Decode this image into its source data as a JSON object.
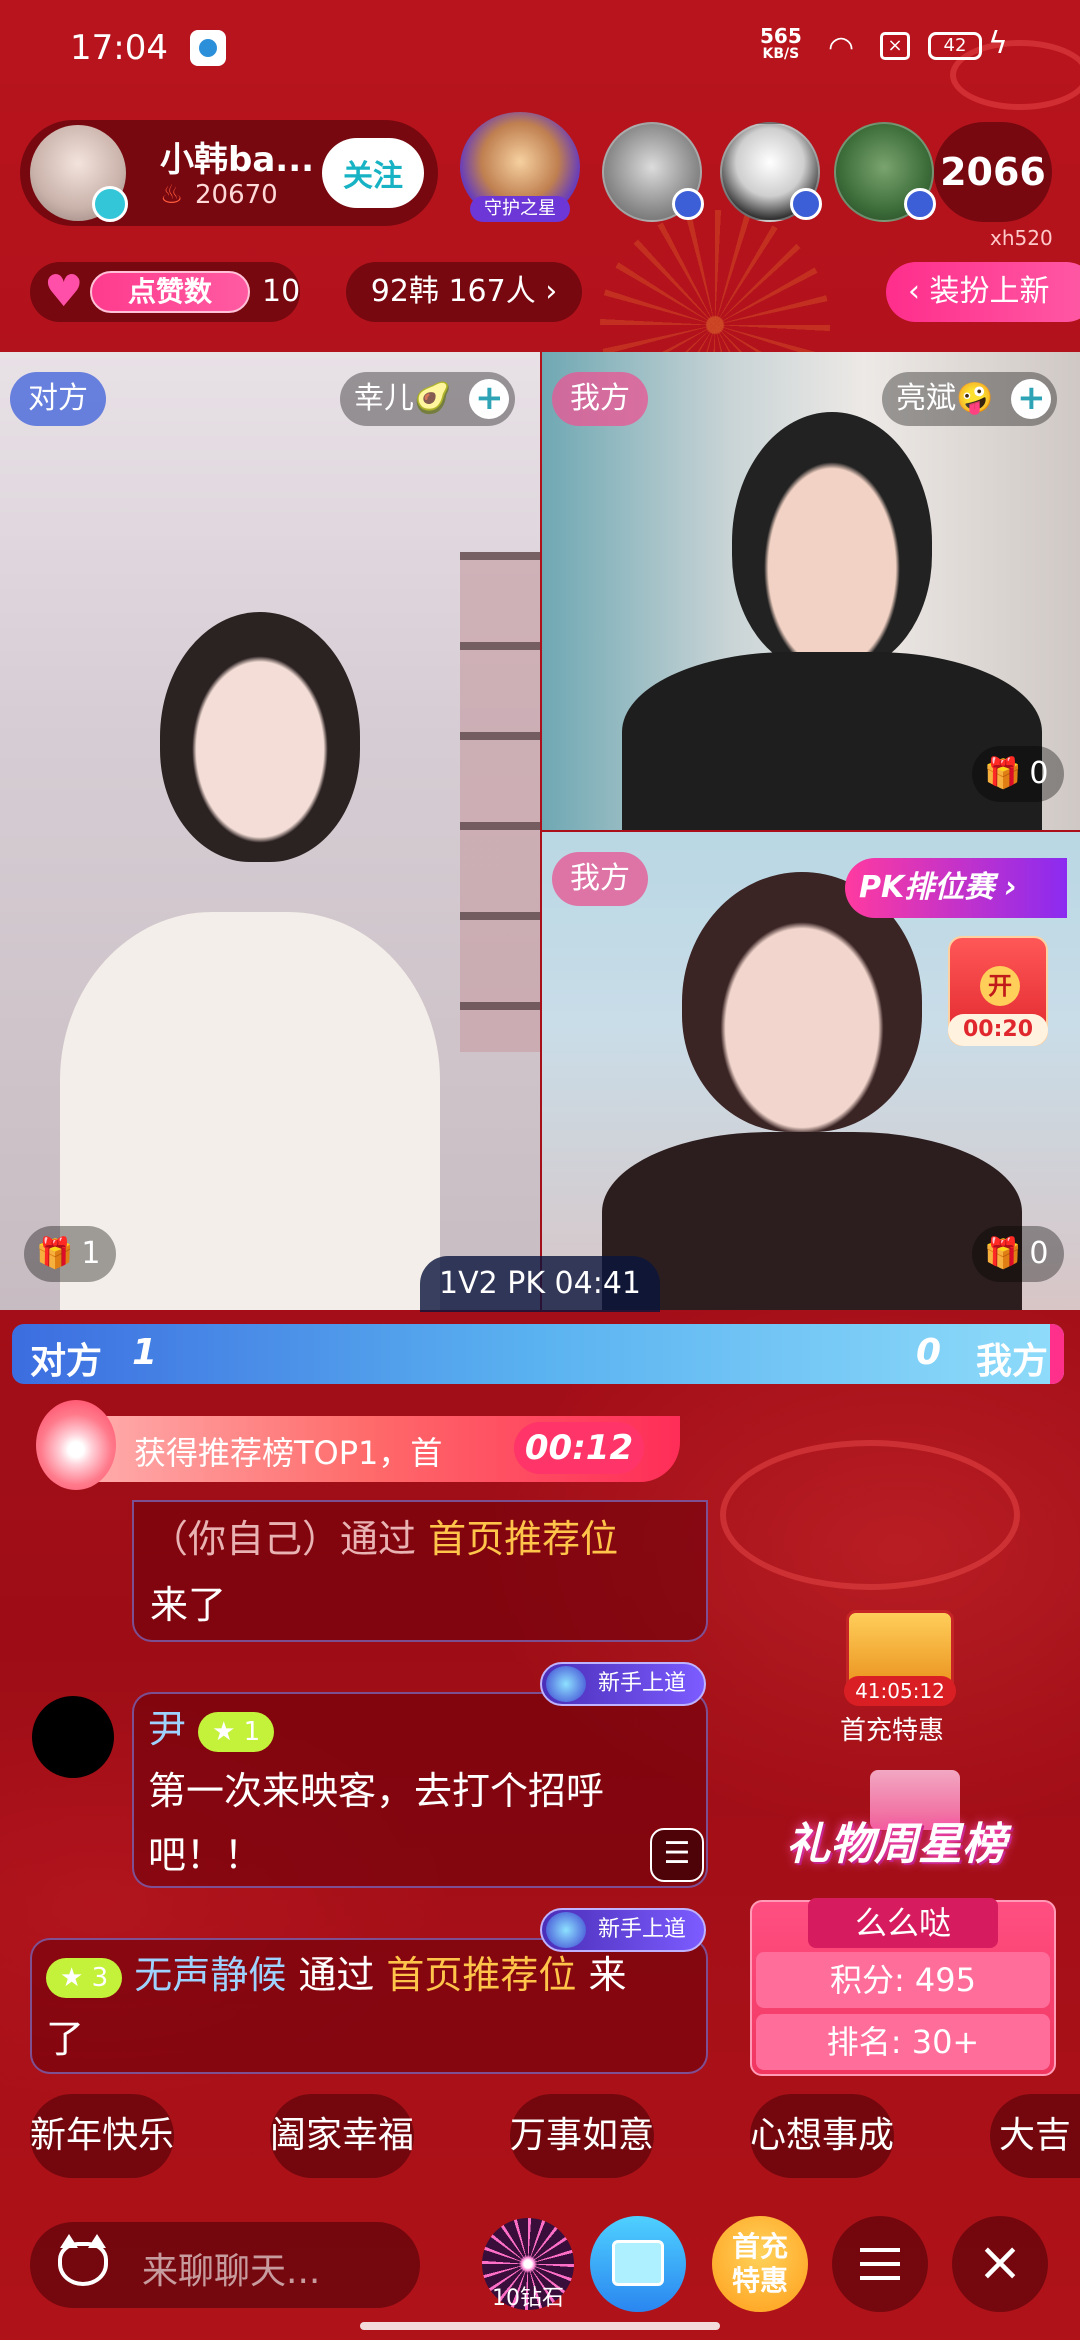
{
  "status_bar": {
    "time": "17:04",
    "net_speed_value": "565",
    "net_speed_unit": "KB/S",
    "battery": "42"
  },
  "header": {
    "host_name": "小韩ba...",
    "host_fans": "20670",
    "follow_label": "关注",
    "guard_label": "守护之星",
    "viewer_count": "2066",
    "user_id": "xh520",
    "likes_label": "点赞数",
    "likes_count": "10",
    "rank_text": "92韩 167人 ›",
    "dress_text": "‹ 装扮上新"
  },
  "pk": {
    "left_tag": "对方",
    "left_name": "幸儿🥑",
    "tr_tag": "我方",
    "tr_name": "亮斌🤪",
    "br_tag": "我方",
    "left_gifts": "1",
    "tr_gifts": "0",
    "br_gifts": "0",
    "timer": "1V2 PK 04:41",
    "rank_badge": "PK排位赛 ›",
    "red_packet_open": "开",
    "red_packet_timer": "00:20",
    "score_left_label": "对方",
    "score_left": "1",
    "score_right": "0",
    "score_right_label": "我方"
  },
  "rec_banner": {
    "text": "获得推荐榜TOP1，首",
    "timer": "00:12"
  },
  "chat": [
    {
      "line1_a": "（你自己）通过 ",
      "line1_b": "首页推荐位",
      "line2": "来了"
    },
    {
      "name": "尹",
      "level": "★ 1",
      "badge": "新手上道",
      "line1": "第一次来映客，去打个招呼",
      "line2": "吧！！"
    },
    {
      "level": "★ 3",
      "badge": "新手上道",
      "name": "无声静候",
      "mid": " 通过 ",
      "place": "首页推荐位",
      "end": " 来",
      "line2": "了"
    }
  ],
  "widgets": {
    "first_charge_timer": "41:05:12",
    "first_charge_label": "首充特惠",
    "gift_week_title": "礼物周星榜",
    "gift_week_name": "么么哒",
    "gift_week_points": "积分: 495",
    "gift_week_rank": "排名: 30+"
  },
  "phrases": [
    "新年快乐",
    "阖家幸福",
    "万事如意",
    "心想事成",
    "大吉"
  ],
  "bottom": {
    "placeholder": "来聊聊天...",
    "firework_label": "10钻石",
    "charge_line1": "首充",
    "charge_line2": "特惠"
  },
  "colors": {
    "background": "#a80f18",
    "accent_pink": "#ff3b8e",
    "accent_blue": "#3c6de0",
    "gold": "#ffc44a"
  }
}
